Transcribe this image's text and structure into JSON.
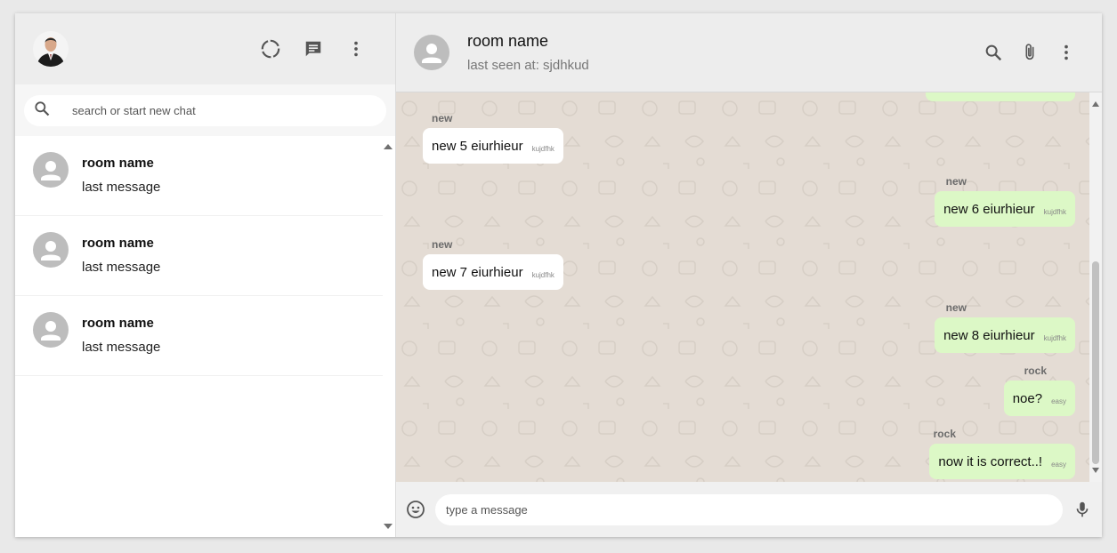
{
  "sidebar": {
    "search_placeholder": "search or start new chat",
    "chats": [
      {
        "name": "room name",
        "last": "last message"
      },
      {
        "name": "room name",
        "last": "last message"
      },
      {
        "name": "room name",
        "last": "last message"
      }
    ],
    "icons": [
      "status-icon",
      "new-chat-icon",
      "more-vert-icon",
      "search-icon"
    ]
  },
  "chat": {
    "title": "room name",
    "subtitle": "last seen at: sjdhkud",
    "input_placeholder": "type a message",
    "messages": [
      {
        "name": "new",
        "text": "new 5 eiurhieur",
        "time": "kujdfhk",
        "dir": "in"
      },
      {
        "name": "new",
        "text": "new 6 eiurhieur",
        "time": "kujdfhk",
        "dir": "out"
      },
      {
        "name": "new",
        "text": "new 7 eiurhieur",
        "time": "kujdfhk",
        "dir": "in"
      },
      {
        "name": "new",
        "text": "new 8 eiurhieur",
        "time": "kujdfhk",
        "dir": "out"
      },
      {
        "name": "rock",
        "text": "noe?",
        "time": "easy",
        "dir": "out"
      },
      {
        "name": "rock",
        "text": "now it is correct..!",
        "time": "easy",
        "dir": "out"
      }
    ]
  },
  "colors": {
    "outgoing_bubble": "#dcf8c6",
    "incoming_bubble": "#ffffff",
    "chat_background": "#e4dcd4",
    "header_background": "#ededed"
  }
}
